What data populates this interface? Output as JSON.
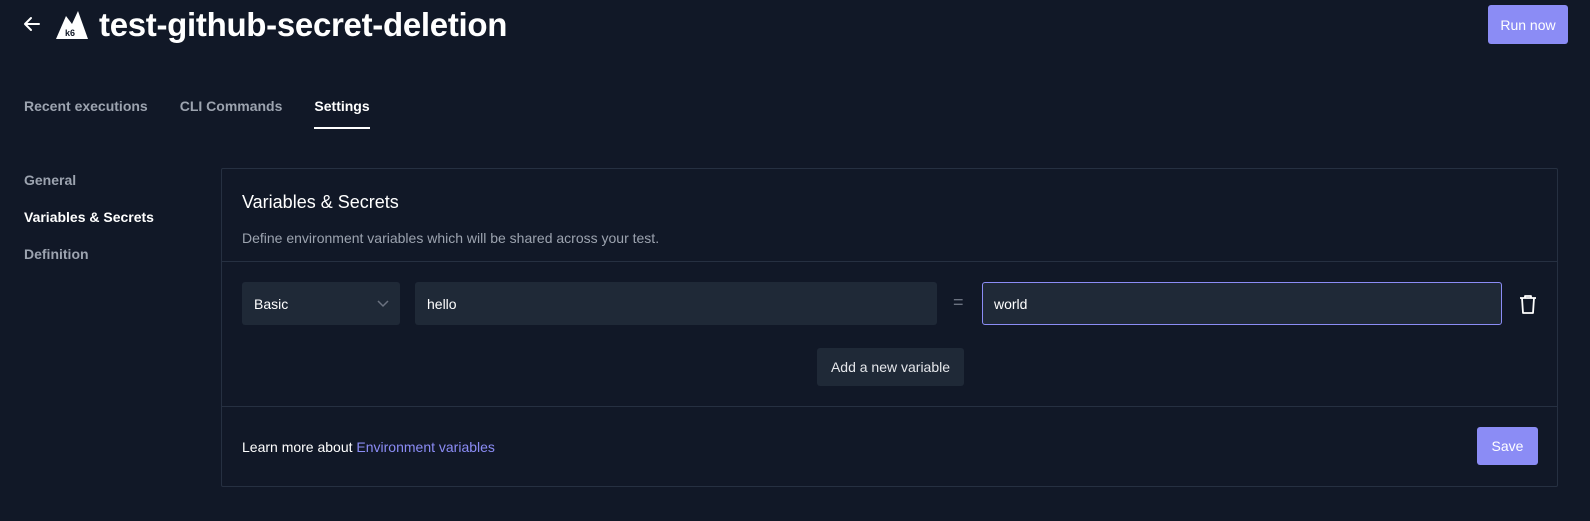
{
  "header": {
    "title": "test-github-secret-deletion",
    "run_label": "Run now"
  },
  "tabs": [
    {
      "label": "Recent executions",
      "active": false
    },
    {
      "label": "CLI Commands",
      "active": false
    },
    {
      "label": "Settings",
      "active": true
    }
  ],
  "sidebar": {
    "items": [
      {
        "label": "General",
        "active": false
      },
      {
        "label": "Variables & Secrets",
        "active": true
      },
      {
        "label": "Definition",
        "active": false
      }
    ]
  },
  "panel": {
    "title": "Variables & Secrets",
    "description": "Define environment variables which will be shared across your test.",
    "variable": {
      "type": "Basic",
      "name": "hello",
      "equals": "=",
      "value": "world"
    },
    "add_label": "Add a new variable",
    "learn_prefix": "Learn more about ",
    "learn_link": "Environment variables",
    "save_label": "Save"
  },
  "colors": {
    "background": "#111827",
    "accent": "#8b8cf5",
    "field": "#1f2937",
    "border": "#263041"
  },
  "icons": {
    "back": "arrow-left-icon",
    "logo": "k6-logo-icon",
    "dropdown": "chevron-down-icon",
    "delete": "trash-icon"
  }
}
